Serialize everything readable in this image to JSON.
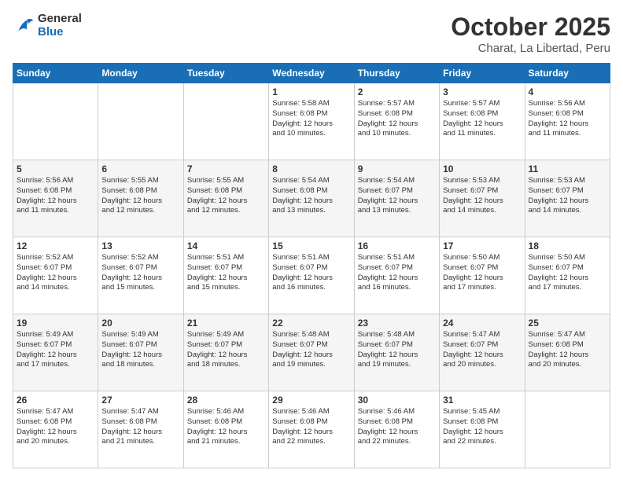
{
  "logo": {
    "line1": "General",
    "line2": "Blue"
  },
  "header": {
    "month": "October 2025",
    "location": "Charat, La Libertad, Peru"
  },
  "weekdays": [
    "Sunday",
    "Monday",
    "Tuesday",
    "Wednesday",
    "Thursday",
    "Friday",
    "Saturday"
  ],
  "weeks": [
    [
      {
        "day": "",
        "text": ""
      },
      {
        "day": "",
        "text": ""
      },
      {
        "day": "",
        "text": ""
      },
      {
        "day": "1",
        "text": "Sunrise: 5:58 AM\nSunset: 6:08 PM\nDaylight: 12 hours\nand 10 minutes."
      },
      {
        "day": "2",
        "text": "Sunrise: 5:57 AM\nSunset: 6:08 PM\nDaylight: 12 hours\nand 10 minutes."
      },
      {
        "day": "3",
        "text": "Sunrise: 5:57 AM\nSunset: 6:08 PM\nDaylight: 12 hours\nand 11 minutes."
      },
      {
        "day": "4",
        "text": "Sunrise: 5:56 AM\nSunset: 6:08 PM\nDaylight: 12 hours\nand 11 minutes."
      }
    ],
    [
      {
        "day": "5",
        "text": "Sunrise: 5:56 AM\nSunset: 6:08 PM\nDaylight: 12 hours\nand 11 minutes."
      },
      {
        "day": "6",
        "text": "Sunrise: 5:55 AM\nSunset: 6:08 PM\nDaylight: 12 hours\nand 12 minutes."
      },
      {
        "day": "7",
        "text": "Sunrise: 5:55 AM\nSunset: 6:08 PM\nDaylight: 12 hours\nand 12 minutes."
      },
      {
        "day": "8",
        "text": "Sunrise: 5:54 AM\nSunset: 6:08 PM\nDaylight: 12 hours\nand 13 minutes."
      },
      {
        "day": "9",
        "text": "Sunrise: 5:54 AM\nSunset: 6:07 PM\nDaylight: 12 hours\nand 13 minutes."
      },
      {
        "day": "10",
        "text": "Sunrise: 5:53 AM\nSunset: 6:07 PM\nDaylight: 12 hours\nand 14 minutes."
      },
      {
        "day": "11",
        "text": "Sunrise: 5:53 AM\nSunset: 6:07 PM\nDaylight: 12 hours\nand 14 minutes."
      }
    ],
    [
      {
        "day": "12",
        "text": "Sunrise: 5:52 AM\nSunset: 6:07 PM\nDaylight: 12 hours\nand 14 minutes."
      },
      {
        "day": "13",
        "text": "Sunrise: 5:52 AM\nSunset: 6:07 PM\nDaylight: 12 hours\nand 15 minutes."
      },
      {
        "day": "14",
        "text": "Sunrise: 5:51 AM\nSunset: 6:07 PM\nDaylight: 12 hours\nand 15 minutes."
      },
      {
        "day": "15",
        "text": "Sunrise: 5:51 AM\nSunset: 6:07 PM\nDaylight: 12 hours\nand 16 minutes."
      },
      {
        "day": "16",
        "text": "Sunrise: 5:51 AM\nSunset: 6:07 PM\nDaylight: 12 hours\nand 16 minutes."
      },
      {
        "day": "17",
        "text": "Sunrise: 5:50 AM\nSunset: 6:07 PM\nDaylight: 12 hours\nand 17 minutes."
      },
      {
        "day": "18",
        "text": "Sunrise: 5:50 AM\nSunset: 6:07 PM\nDaylight: 12 hours\nand 17 minutes."
      }
    ],
    [
      {
        "day": "19",
        "text": "Sunrise: 5:49 AM\nSunset: 6:07 PM\nDaylight: 12 hours\nand 17 minutes."
      },
      {
        "day": "20",
        "text": "Sunrise: 5:49 AM\nSunset: 6:07 PM\nDaylight: 12 hours\nand 18 minutes."
      },
      {
        "day": "21",
        "text": "Sunrise: 5:49 AM\nSunset: 6:07 PM\nDaylight: 12 hours\nand 18 minutes."
      },
      {
        "day": "22",
        "text": "Sunrise: 5:48 AM\nSunset: 6:07 PM\nDaylight: 12 hours\nand 19 minutes."
      },
      {
        "day": "23",
        "text": "Sunrise: 5:48 AM\nSunset: 6:07 PM\nDaylight: 12 hours\nand 19 minutes."
      },
      {
        "day": "24",
        "text": "Sunrise: 5:47 AM\nSunset: 6:07 PM\nDaylight: 12 hours\nand 20 minutes."
      },
      {
        "day": "25",
        "text": "Sunrise: 5:47 AM\nSunset: 6:08 PM\nDaylight: 12 hours\nand 20 minutes."
      }
    ],
    [
      {
        "day": "26",
        "text": "Sunrise: 5:47 AM\nSunset: 6:08 PM\nDaylight: 12 hours\nand 20 minutes."
      },
      {
        "day": "27",
        "text": "Sunrise: 5:47 AM\nSunset: 6:08 PM\nDaylight: 12 hours\nand 21 minutes."
      },
      {
        "day": "28",
        "text": "Sunrise: 5:46 AM\nSunset: 6:08 PM\nDaylight: 12 hours\nand 21 minutes."
      },
      {
        "day": "29",
        "text": "Sunrise: 5:46 AM\nSunset: 6:08 PM\nDaylight: 12 hours\nand 22 minutes."
      },
      {
        "day": "30",
        "text": "Sunrise: 5:46 AM\nSunset: 6:08 PM\nDaylight: 12 hours\nand 22 minutes."
      },
      {
        "day": "31",
        "text": "Sunrise: 5:45 AM\nSunset: 6:08 PM\nDaylight: 12 hours\nand 22 minutes."
      },
      {
        "day": "",
        "text": ""
      }
    ]
  ]
}
